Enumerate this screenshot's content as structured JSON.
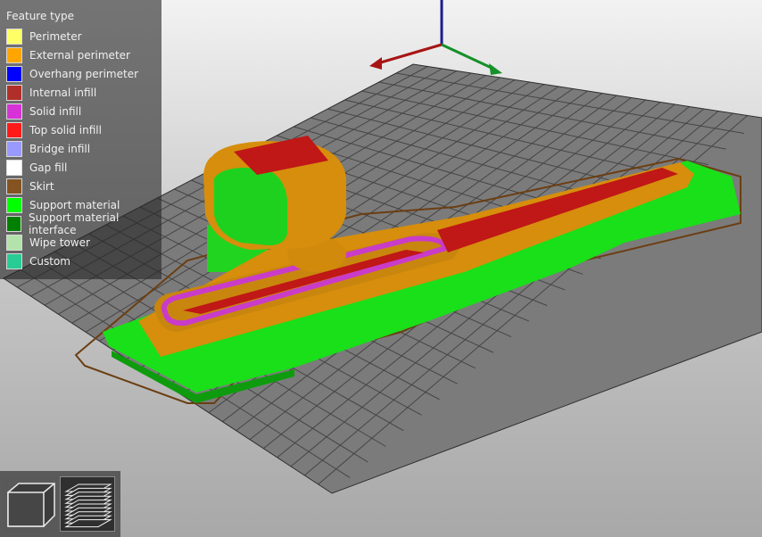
{
  "legend": {
    "title": "Feature type",
    "items": [
      {
        "label": "Perimeter",
        "color": "#ffff66"
      },
      {
        "label": "External perimeter",
        "color": "#ffa500"
      },
      {
        "label": "Overhang perimeter",
        "color": "#0000ff"
      },
      {
        "label": "Internal infill",
        "color": "#b03029"
      },
      {
        "label": "Solid infill",
        "color": "#d732d7"
      },
      {
        "label": "Top solid infill",
        "color": "#ff1a1a"
      },
      {
        "label": "Bridge infill",
        "color": "#9999ff"
      },
      {
        "label": "Gap fill",
        "color": "#ffffff"
      },
      {
        "label": "Skirt",
        "color": "#845321"
      },
      {
        "label": "Support material",
        "color": "#00ff00"
      },
      {
        "label": "Support material interface",
        "color": "#008000"
      },
      {
        "label": "Wipe tower",
        "color": "#b3e3ab"
      },
      {
        "label": "Custom",
        "color": "#28cc94"
      }
    ]
  },
  "toolbar": {
    "view_3d_icon": "cube-icon",
    "layers_icon": "layers-icon"
  }
}
